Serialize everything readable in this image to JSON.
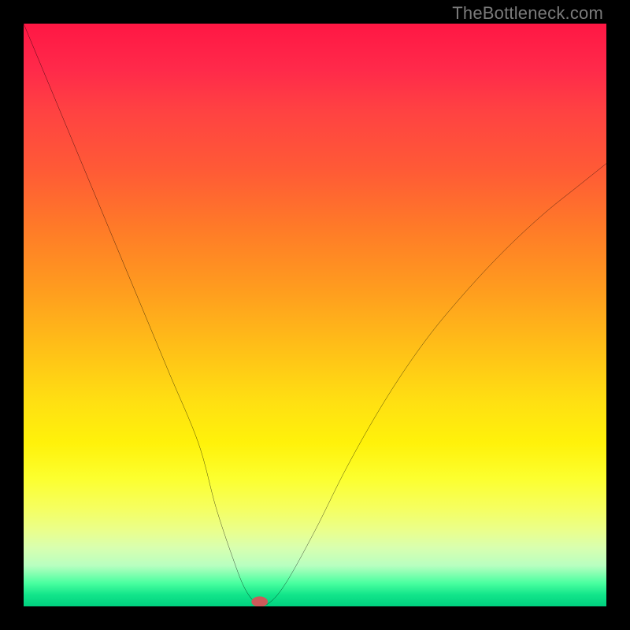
{
  "watermark": "TheBottleneck.com",
  "chart_data": {
    "type": "line",
    "title": "",
    "xlabel": "",
    "ylabel": "",
    "xlim": [
      0,
      100
    ],
    "ylim": [
      0,
      100
    ],
    "grid": false,
    "legend": false,
    "series": [
      {
        "name": "bottleneck-curve",
        "color": "#000000",
        "x": [
          0,
          5,
          10,
          15,
          20,
          25,
          30,
          33,
          36,
          38,
          40,
          42,
          45,
          50,
          55,
          60,
          65,
          70,
          75,
          80,
          85,
          90,
          95,
          100
        ],
        "y": [
          100,
          88,
          76,
          64,
          52,
          40,
          28,
          17,
          8,
          3,
          0.5,
          0.5,
          4,
          13,
          23,
          32,
          40,
          47,
          53,
          58.5,
          63.5,
          68,
          72,
          76
        ]
      }
    ],
    "marker": {
      "name": "optimal-point",
      "x": 40.5,
      "y": 0.8,
      "color": "#cc5a5a",
      "rx": 1.4,
      "ry": 0.9
    },
    "background_gradient": {
      "direction": "vertical",
      "stops": [
        {
          "pos": 0,
          "color": "#ff1744"
        },
        {
          "pos": 15,
          "color": "#ff4242"
        },
        {
          "pos": 35,
          "color": "#ff7a28"
        },
        {
          "pos": 55,
          "color": "#ffbd18"
        },
        {
          "pos": 72,
          "color": "#fff20a"
        },
        {
          "pos": 87,
          "color": "#eaff8c"
        },
        {
          "pos": 96,
          "color": "#4affa0"
        },
        {
          "pos": 100,
          "color": "#00d07f"
        }
      ]
    }
  }
}
